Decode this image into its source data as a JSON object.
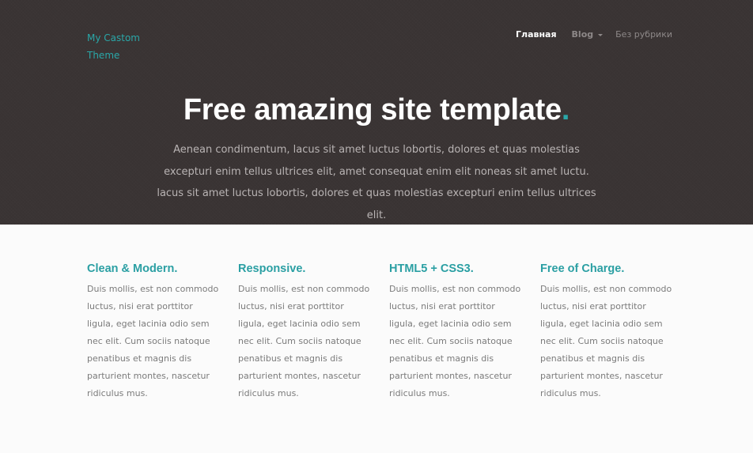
{
  "brand": {
    "line1": "My Castom",
    "line2": "Theme"
  },
  "nav": {
    "items": [
      {
        "label": "Главная"
      },
      {
        "label": "Blog"
      },
      {
        "label": "Без рубрики"
      }
    ]
  },
  "hero": {
    "title": "Free amazing site template",
    "title_dot": ".",
    "text": "Aenean condimentum, lacus sit amet luctus lobortis, dolores et quas molestias excepturi enim tellus ultrices elit, amet consequat enim elit noneas sit amet luctu. lacus sit amet luctus lobortis, dolores et quas molestias excepturi enim tellus ultrices elit."
  },
  "features": [
    {
      "title": "Clean & Modern.",
      "text": "Duis mollis, est non commodo luctus, nisi erat porttitor ligula, eget lacinia odio sem nec elit. Cum sociis natoque penatibus et magnis dis parturient montes, nascetur ridiculus mus."
    },
    {
      "title": "Responsive.",
      "text": "Duis mollis, est non commodo luctus, nisi erat porttitor ligula, eget lacinia odio sem nec elit. Cum sociis natoque penatibus et magnis dis parturient montes, nascetur ridiculus mus."
    },
    {
      "title": "HTML5 + CSS3.",
      "text": "Duis mollis, est non commodo luctus, nisi erat porttitor ligula, eget lacinia odio sem nec elit. Cum sociis natoque penatibus et magnis dis parturient montes, nascetur ridiculus mus."
    },
    {
      "title": "Free of Charge.",
      "text": "Duis mollis, est non commodo luctus, nisi erat porttitor ligula, eget lacinia odio sem nec elit. Cum sociis natoque penatibus et magnis dis parturient montes, nascetur ridiculus mus."
    }
  ],
  "colors": {
    "accent": "#2aa7a8",
    "hero_background": "#3a3434",
    "page_background": "#fbfbfb"
  }
}
